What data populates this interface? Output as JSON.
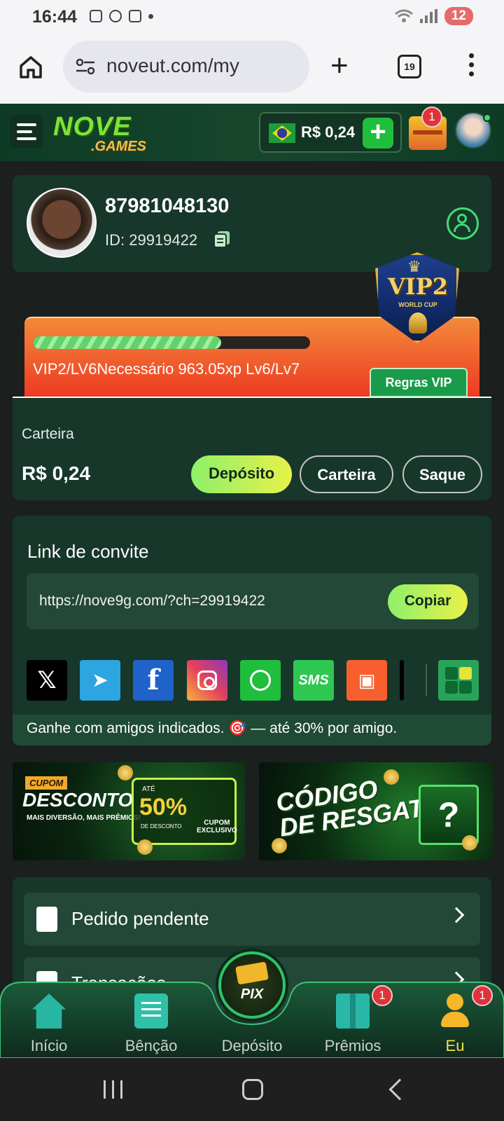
{
  "status_bar": {
    "time": "16:44",
    "battery": "12"
  },
  "browser": {
    "url": "noveut.com/my",
    "tab_count": "19"
  },
  "header": {
    "logo_main": "NOVE",
    "logo_sub": ".GAMES",
    "balance": "R$ 0,24",
    "chest_badge": "1"
  },
  "profile": {
    "phone": "87981048130",
    "id_text": "ID: 29919422"
  },
  "vip": {
    "badge_label": "VIP2",
    "badge_sub": "WORLD CUP",
    "progress_fraction": 0.68,
    "status_text": "VIP2/LV6Necessário 963.05xp Lv6/Lv7",
    "rules_button": "Regras VIP"
  },
  "wallet": {
    "label": "Carteira",
    "amount": "R$ 0,24",
    "deposit_button": "Depósito",
    "wallet_button": "Carteira",
    "withdraw_button": "Saque"
  },
  "invite": {
    "title": "Link de convite",
    "link": "https://nove9g.com/?ch=29919422",
    "copy_button": "Copiar",
    "socials": [
      "X",
      "Telegram",
      "Facebook",
      "Instagram",
      "WhatsApp",
      "SMS",
      "Kwai",
      "More"
    ],
    "footer": "Ganhe com amigos indicados. 🎯 — até 30% por amigo."
  },
  "banners": {
    "coupon": {
      "tag": "CUPOM",
      "title": "DESCONTO",
      "subtitle": "MAIS DIVERSÃO, MAIS PRÊMIOS!",
      "upto": "ATÉ",
      "percent": "50%",
      "discount_label": "DE DESCONTO",
      "exclusive": "CUPOM EXCLUSIVO"
    },
    "redeem": {
      "title_line1": "CÓDIGO",
      "title_line2": "DE RESGATE",
      "symbol": "?"
    }
  },
  "menu": {
    "items": [
      {
        "label": "Pedido pendente"
      },
      {
        "label": "Transações"
      }
    ]
  },
  "bottom_nav": {
    "items": [
      {
        "label": "Início"
      },
      {
        "label": "Bênção"
      },
      {
        "label": "Depósito",
        "center_text": "PIX"
      },
      {
        "label": "Prêmios",
        "badge": "1"
      },
      {
        "label": "Eu",
        "badge": "1"
      }
    ]
  },
  "colors": {
    "accent_green": "#8ff06a",
    "header_green": "#17462d",
    "card_bg": "#17372a",
    "vip_orange": "#f38a3a",
    "badge_red": "#e0323a",
    "eu_yellow": "#f1e34a"
  }
}
